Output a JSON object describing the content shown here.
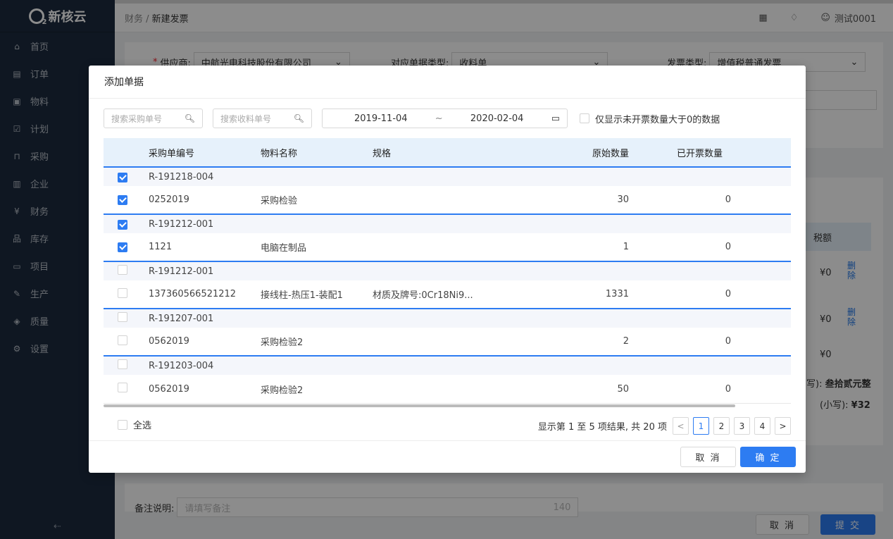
{
  "app": {
    "logo_text": "新核云"
  },
  "sidebar": {
    "items": [
      {
        "label": "首页",
        "icon": "home-icon",
        "glyph": "⌂"
      },
      {
        "label": "订单",
        "icon": "order-icon",
        "glyph": "▤"
      },
      {
        "label": "物料",
        "icon": "material-icon",
        "glyph": "▣"
      },
      {
        "label": "计划",
        "icon": "plan-icon",
        "glyph": "☑"
      },
      {
        "label": "采购",
        "icon": "purchase-icon",
        "glyph": "⊓"
      },
      {
        "label": "企业",
        "icon": "enterprise-icon",
        "glyph": "▥"
      },
      {
        "label": "财务",
        "icon": "finance-icon",
        "glyph": "¥"
      },
      {
        "label": "库存",
        "icon": "inventory-icon",
        "glyph": "品"
      },
      {
        "label": "项目",
        "icon": "project-icon",
        "glyph": "▭"
      },
      {
        "label": "生产",
        "icon": "production-icon",
        "glyph": "✎"
      },
      {
        "label": "质量",
        "icon": "quality-icon",
        "glyph": "◈"
      },
      {
        "label": "设置",
        "icon": "settings-icon",
        "glyph": "⚙"
      }
    ],
    "collapse_glyph": "⇠"
  },
  "header": {
    "crumb_parent": "财务",
    "crumb_sep": " / ",
    "crumb_current": "新建发票",
    "user": "测试0001"
  },
  "background_form": {
    "supplier_label": "供应商:",
    "supplier_value": "中航光电科技股份有限公司",
    "doc_type_label": "对应单据类型:",
    "doc_type_value": "收料单",
    "invoice_type_label": "发票类型:",
    "invoice_type_value": "增值税普通发票",
    "tax_col": "税额",
    "tax_values": [
      "¥0",
      "¥0",
      "¥0"
    ],
    "delete_label": "删除",
    "upper_amount_label": "写):",
    "upper_amount": "叁拾贰元整",
    "lower_amount_label": "(小写):",
    "lower_amount": "¥32",
    "remark_label": "备注说明:",
    "remark_placeholder": "请填写备注",
    "remark_count": "140",
    "cancel": "取 消",
    "submit": "提 交"
  },
  "modal": {
    "title": "添加单据",
    "search_po_placeholder": "搜索采购单号",
    "search_receipt_placeholder": "搜索收料单号",
    "date_start": "2019-11-04",
    "date_sep": "~",
    "date_end": "2020-02-04",
    "only_uninvoiced_label": "仅显示未开票数量大于0的数据",
    "columns": [
      "采购单编号",
      "物料名称",
      "规格",
      "原始数量",
      "已开票数量"
    ],
    "groups": [
      {
        "code": "R-191218-004",
        "checked": true,
        "row": {
          "no": "0252019",
          "name": "采购检验",
          "spec": "",
          "orig": "30",
          "invoiced": "0",
          "checked": true
        }
      },
      {
        "code": "R-191212-001",
        "checked": true,
        "row": {
          "no": "1121",
          "name": "电脑在制品",
          "spec": "",
          "orig": "1",
          "invoiced": "0",
          "checked": true
        }
      },
      {
        "code": "R-191212-001",
        "checked": false,
        "row": {
          "no": "137360566521212",
          "name": "接线柱-热压1-装配1",
          "spec": "材质及牌号:0Cr18Ni9...",
          "orig": "1331",
          "invoiced": "0",
          "checked": false
        }
      },
      {
        "code": "R-191207-001",
        "checked": false,
        "row": {
          "no": "0562019",
          "name": "采购检验2",
          "spec": "",
          "orig": "2",
          "invoiced": "0",
          "checked": false
        }
      },
      {
        "code": "R-191203-004",
        "checked": false,
        "row": {
          "no": "0562019",
          "name": "采购检验2",
          "spec": "",
          "orig": "50",
          "invoiced": "0",
          "checked": false
        }
      }
    ],
    "select_all_label": "全选",
    "pagination_summary": "显示第 1 至 5 项结果, 共 20 项",
    "pages": [
      "1",
      "2",
      "3",
      "4"
    ],
    "prev": "<",
    "next": ">",
    "cancel": "取 消",
    "confirm": "确 定"
  },
  "colors": {
    "accent": "#2d7cf2",
    "sidebar": "#1c2a3e"
  }
}
